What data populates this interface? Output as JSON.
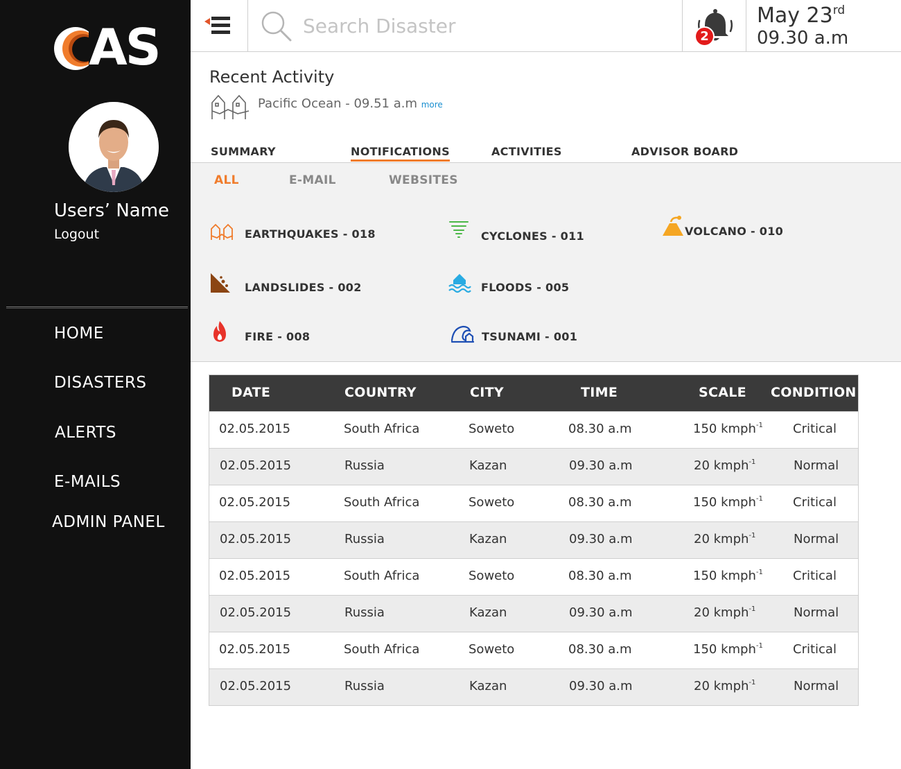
{
  "sidebar": {
    "logo": "AS",
    "user_name": "Users’  Name",
    "logout": "Logout",
    "nav": [
      "HOME",
      "DISASTERS",
      "ALERTS",
      "E-MAILS",
      "ADMIN PANEL"
    ]
  },
  "topbar": {
    "search_placeholder": "Search Disaster",
    "notification_count": "2",
    "date": "May 23",
    "date_suffix": "rd",
    "time": "09.30 a.m"
  },
  "recent": {
    "title": "Recent Activity",
    "item": "Pacific Ocean - 09.51 a.m",
    "more": "more"
  },
  "tabs": [
    "SUMMARY",
    "NOTIFICATIONS",
    "ACTIVITIES",
    "ADVISOR BOARD"
  ],
  "active_tab": "NOTIFICATIONS",
  "subtabs": [
    "ALL",
    "E-MAIL",
    "WEBSITES"
  ],
  "active_subtab": "ALL",
  "categories": [
    {
      "label": "EARTHQUAKES - 018",
      "icon": "earthquake-icon",
      "color": "#f07c2c"
    },
    {
      "label": "CYCLONES - 011",
      "icon": "cyclone-icon",
      "color": "#4cb848"
    },
    {
      "label": "VOLCANO - 010",
      "icon": "volcano-icon",
      "color": "#f5a623"
    },
    {
      "label": "LANDSLIDES - 002",
      "icon": "landslide-icon",
      "color": "#8b4513"
    },
    {
      "label": "FLOODS - 005",
      "icon": "flood-icon",
      "color": "#29abe2"
    },
    {
      "label": "FIRE - 008",
      "icon": "fire-icon",
      "color": "#e8332a"
    },
    {
      "label": "TSUNAMI - 001",
      "icon": "tsunami-icon",
      "color": "#1e4fb4"
    }
  ],
  "table": {
    "headers": [
      "DATE",
      "COUNTRY",
      "CITY",
      "TIME",
      "SCALE",
      "CONDITION"
    ],
    "rows": [
      [
        "02.05.2015",
        "South Africa",
        "Soweto",
        "08.30 a.m",
        "150 kmph",
        "Critical"
      ],
      [
        "02.05.2015",
        "Russia",
        "Kazan",
        "09.30 a.m",
        "20 kmph",
        "Normal"
      ],
      [
        "02.05.2015",
        "South Africa",
        "Soweto",
        "08.30 a.m",
        "150 kmph",
        "Critical"
      ],
      [
        "02.05.2015",
        "Russia",
        "Kazan",
        "09.30 a.m",
        "20 kmph",
        "Normal"
      ],
      [
        "02.05.2015",
        "South Africa",
        "Soweto",
        "08.30 a.m",
        "150 kmph",
        "Critical"
      ],
      [
        "02.05.2015",
        "Russia",
        "Kazan",
        "09.30 a.m",
        "20 kmph",
        "Normal"
      ],
      [
        "02.05.2015",
        "South Africa",
        "Soweto",
        "08.30 a.m",
        "150 kmph",
        "Critical"
      ],
      [
        "02.05.2015",
        "Russia",
        "Kazan",
        "09.30 a.m",
        "20 kmph",
        "Normal"
      ]
    ],
    "scale_unit_exponent": "-1"
  },
  "colors": {
    "sidebar_bg": "#111111",
    "accent": "#f07c2c",
    "table_header_bg": "#3a3a3a",
    "badge": "#e21b1b"
  }
}
